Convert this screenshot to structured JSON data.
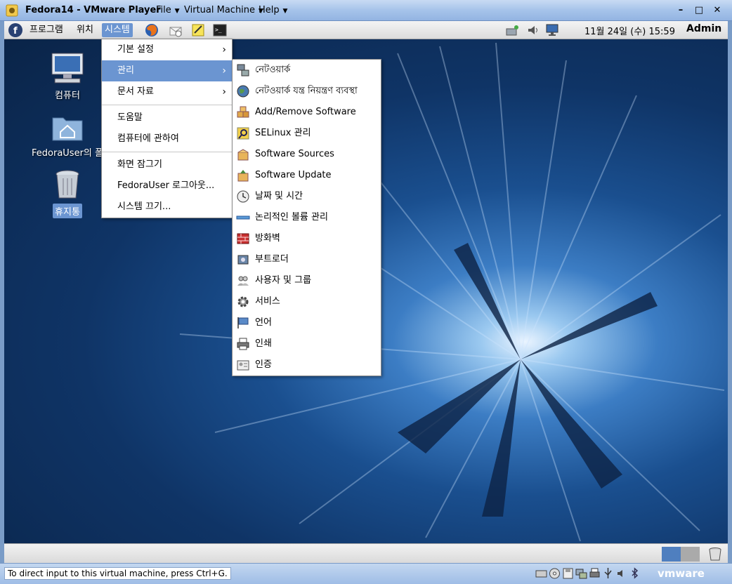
{
  "window": {
    "title": "Fedora14 - VMware Player",
    "menu": [
      {
        "label": "File"
      },
      {
        "label": "Virtual Machine"
      },
      {
        "label": "Help"
      }
    ],
    "controls": {
      "minimize": "–",
      "maximize": "□",
      "close": "✕"
    }
  },
  "panel": {
    "menus": [
      "프로그램",
      "위치",
      "시스템"
    ],
    "clock": "11월 24일 (수) 15:59",
    "user": "Admin"
  },
  "desktop": {
    "icons": [
      {
        "label": "컴퓨터",
        "icon": "computer-icon"
      },
      {
        "label": "FedoraUser의 폴",
        "icon": "home-folder-icon"
      },
      {
        "label": "휴지통",
        "icon": "trash-icon"
      }
    ]
  },
  "system_menu": {
    "items": [
      {
        "label": "기본 설정",
        "submenu": true
      },
      {
        "label": "관리",
        "submenu": true,
        "highlighted": true
      },
      {
        "label": "문서 자료",
        "submenu": true
      },
      {
        "label": "도움말"
      },
      {
        "label": "컴퓨터에 관하여"
      },
      {
        "label": "화면 잠그기"
      },
      {
        "label": "FedoraUser 로그아웃..."
      },
      {
        "label": "시스템 끄기..."
      }
    ]
  },
  "admin_menu": {
    "items": [
      {
        "label": "নেটওয়ার্ক",
        "icon": "network-icon"
      },
      {
        "label": "নেটওয়ার্ক যন্ত্র নিয়ন্ত্রণ ব্যবস্থা",
        "icon": "globe-icon"
      },
      {
        "label": "Add/Remove Software",
        "icon": "packages-icon"
      },
      {
        "label": "SELinux 관리",
        "icon": "selinux-icon"
      },
      {
        "label": "Software Sources",
        "icon": "software-sources-icon"
      },
      {
        "label": "Software Update",
        "icon": "software-update-icon"
      },
      {
        "label": "날짜 및 시간",
        "icon": "clock-icon"
      },
      {
        "label": "논리적인 볼륨 관리",
        "icon": "volume-icon"
      },
      {
        "label": "방화벽",
        "icon": "firewall-icon"
      },
      {
        "label": "부트로더",
        "icon": "bootloader-icon"
      },
      {
        "label": "사용자 및 그룹",
        "icon": "users-icon"
      },
      {
        "label": "서비스",
        "icon": "gear-icon"
      },
      {
        "label": "언어",
        "icon": "language-flag-icon"
      },
      {
        "label": "인쇄",
        "icon": "printer-icon"
      },
      {
        "label": "인증",
        "icon": "authentication-icon"
      }
    ]
  },
  "statusbar": {
    "message": "To direct input to this virtual machine, press Ctrl+G.",
    "brand": "vmware"
  },
  "colors": {
    "highlight": "#6b95d1",
    "desktop_dark": "#0f3466",
    "desktop_light": "#9bc9f0"
  }
}
